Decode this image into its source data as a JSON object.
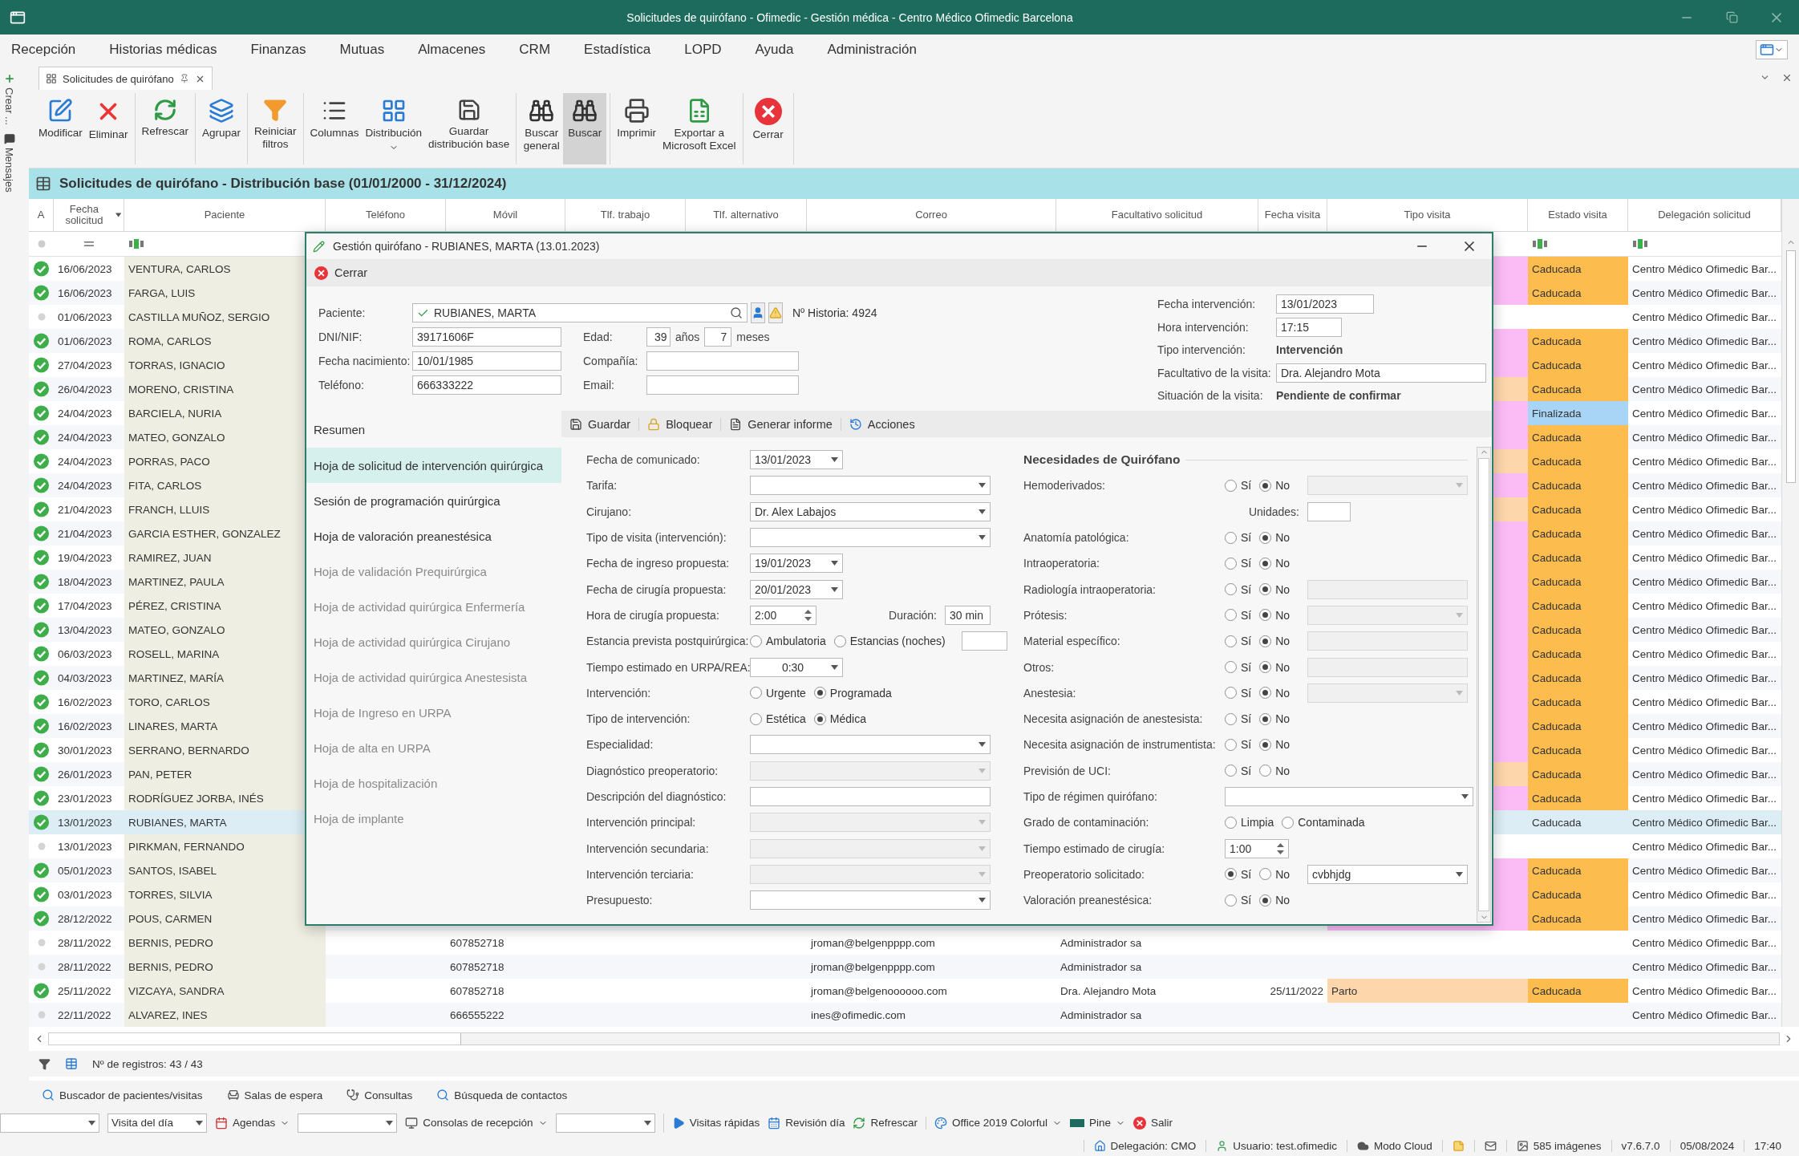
{
  "window": {
    "title": "Solicitudes de quirófano - Ofimedic - Gestión médica - Centro Médico Ofimedic Barcelona"
  },
  "menu": [
    "Recepción",
    "Historias médicas",
    "Finanzas",
    "Mutuas",
    "Almacenes",
    "CRM",
    "Estadística",
    "LOPD",
    "Ayuda",
    "Administración"
  ],
  "side_strip": [
    "Crear ...",
    "Mensajes"
  ],
  "doc_tab": {
    "label": "Solicitudes de quirófano"
  },
  "ribbon": {
    "groups": [
      [
        {
          "label": "Modificar",
          "pressed": false,
          "dropdown": false
        },
        {
          "label": "Eliminar",
          "pressed": false,
          "dropdown": false
        }
      ],
      [
        {
          "label": "Refrescar",
          "pressed": false,
          "dropdown": false
        }
      ],
      [
        {
          "label": "Agrupar",
          "pressed": false,
          "dropdown": false
        }
      ],
      [
        {
          "label": "Reiniciar\nfiltros",
          "pressed": false,
          "dropdown": false
        }
      ],
      [
        {
          "label": "Columnas",
          "pressed": false,
          "dropdown": false
        },
        {
          "label": "Distribución",
          "pressed": false,
          "dropdown": true
        },
        {
          "label": "Guardar\ndistribución base",
          "pressed": false,
          "dropdown": false
        }
      ],
      [
        {
          "label": "Buscar\ngeneral",
          "pressed": false,
          "dropdown": false
        },
        {
          "label": "Buscar",
          "pressed": true,
          "dropdown": false
        }
      ],
      [
        {
          "label": "Imprimir",
          "pressed": false,
          "dropdown": false
        },
        {
          "label": "Exportar a\nMicrosoft Excel",
          "pressed": false,
          "dropdown": false
        }
      ],
      [
        {
          "label": "Cerrar",
          "pressed": false,
          "dropdown": false
        }
      ]
    ]
  },
  "grid": {
    "title": "Solicitudes de quirófano - Distribución base (01/01/2000 - 31/12/2024)",
    "columns": [
      {
        "label": "A",
        "sorted": false
      },
      {
        "label": "Fecha solicitud",
        "sorted": true
      },
      {
        "label": "Paciente",
        "sorted": false
      },
      {
        "label": "Teléfono",
        "sorted": false
      },
      {
        "label": "Móvil",
        "sorted": false
      },
      {
        "label": "Tlf. trabajo",
        "sorted": false
      },
      {
        "label": "Tlf. alternativo",
        "sorted": false
      },
      {
        "label": "Correo",
        "sorted": false
      },
      {
        "label": "Facultativo solicitud",
        "sorted": false
      },
      {
        "label": "Fecha visita",
        "sorted": false
      },
      {
        "label": "Tipo visita",
        "sorted": false
      },
      {
        "label": "Estado visita",
        "sorted": false
      },
      {
        "label": "Delegación solicitud",
        "sorted": false
      }
    ],
    "rows": [
      {
        "confirmed": true,
        "fecha": "16/06/2023",
        "paciente": "VENTURA, CARLOS",
        "tipo_visita": {
          "color": "#fbbcf6"
        },
        "estado": {
          "label": "Caducada",
          "color": "#fcbd4e"
        },
        "delegacion": "Centro Médico Ofimedic Bar...",
        "selected": false
      },
      {
        "confirmed": true,
        "fecha": "16/06/2023",
        "paciente": "FARGA, LUIS",
        "tipo_visita": {
          "color": "#fbbcf6"
        },
        "estado": {
          "label": "Caducada",
          "color": "#fcbd4e"
        },
        "delegacion": "Centro Médico Ofimedic Bar...",
        "selected": false
      },
      {
        "confirmed": false,
        "fecha": "01/06/2023",
        "paciente": "CASTILLA MUÑOZ, SERGIO",
        "delegacion": "Centro Médico Ofimedic Bar...",
        "selected": false
      },
      {
        "confirmed": true,
        "fecha": "01/06/2023",
        "paciente": "ROMA, CARLOS",
        "tipo_visita": {
          "color": "#fbbcf6"
        },
        "estado": {
          "label": "Caducada",
          "color": "#fcbd4e"
        },
        "delegacion": "Centro Médico Ofimedic Bar...",
        "selected": false
      },
      {
        "confirmed": true,
        "fecha": "27/04/2023",
        "paciente": "TORRAS, IGNACIO",
        "tipo_visita": {
          "color": "#fbbcf6"
        },
        "estado": {
          "label": "Caducada",
          "color": "#fcbd4e"
        },
        "delegacion": "Centro Médico Ofimedic Bar...",
        "selected": false
      },
      {
        "confirmed": true,
        "fecha": "26/04/2023",
        "paciente": "MORENO, CRISTINA",
        "tipo_visita": {
          "color": "#fdd6ac"
        },
        "estado": {
          "label": "Caducada",
          "color": "#fcbd4e"
        },
        "delegacion": "Centro Médico Ofimedic Bar...",
        "selected": false
      },
      {
        "confirmed": true,
        "fecha": "24/04/2023",
        "paciente": "BARCIELA, NURIA",
        "tipo_visita": {
          "color": "#fbbcf6"
        },
        "estado": {
          "label": "Finalizada",
          "color": "#a8d4f5"
        },
        "delegacion": "Centro Médico Ofimedic Bar...",
        "selected": false
      },
      {
        "confirmed": true,
        "fecha": "24/04/2023",
        "paciente": "MATEO, GONZALO",
        "tipo_visita": {
          "color": "#fbbcf6"
        },
        "estado": {
          "label": "Caducada",
          "color": "#fcbd4e"
        },
        "delegacion": "Centro Médico Ofimedic Bar...",
        "selected": false
      },
      {
        "confirmed": true,
        "fecha": "24/04/2023",
        "paciente": "PORRAS, PACO",
        "tipo_visita": {
          "color": "#fdd6ac"
        },
        "estado": {
          "label": "Caducada",
          "color": "#fcbd4e"
        },
        "delegacion": "Centro Médico Ofimedic Bar...",
        "selected": false
      },
      {
        "confirmed": true,
        "fecha": "24/04/2023",
        "paciente": "FITA, CARLOS",
        "tipo_visita": {
          "color": "#fbbcf6"
        },
        "estado": {
          "label": "Caducada",
          "color": "#fcbd4e"
        },
        "delegacion": "Centro Médico Ofimedic Bar...",
        "selected": false
      },
      {
        "confirmed": true,
        "fecha": "21/04/2023",
        "paciente": "FRANCH, LLUIS",
        "tipo_visita": {
          "color": "#fdd6ac"
        },
        "estado": {
          "label": "Caducada",
          "color": "#fcbd4e"
        },
        "delegacion": "Centro Médico Ofimedic Bar...",
        "selected": false
      },
      {
        "confirmed": true,
        "fecha": "21/04/2023",
        "paciente": "GARCIA ESTHER, GONZALEZ",
        "tipo_visita": {
          "color": "#fbbcf6"
        },
        "estado": {
          "label": "Caducada",
          "color": "#fcbd4e"
        },
        "delegacion": "Centro Médico Ofimedic Bar...",
        "selected": false
      },
      {
        "confirmed": true,
        "fecha": "19/04/2023",
        "paciente": "RAMIREZ, JUAN",
        "tipo_visita": {
          "color": "#fbbcf6"
        },
        "estado": {
          "label": "Caducada",
          "color": "#fcbd4e"
        },
        "delegacion": "Centro Médico Ofimedic Bar...",
        "selected": false
      },
      {
        "confirmed": true,
        "fecha": "18/04/2023",
        "paciente": "MARTINEZ, PAULA",
        "tipo_visita": {
          "color": "#fbbcf6"
        },
        "estado": {
          "label": "Caducada",
          "color": "#fcbd4e"
        },
        "delegacion": "Centro Médico Ofimedic Bar...",
        "selected": false
      },
      {
        "confirmed": true,
        "fecha": "17/04/2023",
        "paciente": "PÉREZ, CRISTINA",
        "tipo_visita": {
          "color": "#fbbcf6"
        },
        "estado": {
          "label": "Caducada",
          "color": "#fcbd4e"
        },
        "delegacion": "Centro Médico Ofimedic Bar...",
        "selected": false
      },
      {
        "confirmed": true,
        "fecha": "13/04/2023",
        "paciente": "MATEO, GONZALO",
        "tipo_visita": {
          "color": "#fbbcf6"
        },
        "estado": {
          "label": "Caducada",
          "color": "#fcbd4e"
        },
        "delegacion": "Centro Médico Ofimedic Bar...",
        "selected": false
      },
      {
        "confirmed": true,
        "fecha": "06/03/2023",
        "paciente": "ROSELL, MARINA",
        "tipo_visita": {
          "color": "#fbbcf6"
        },
        "estado": {
          "label": "Caducada",
          "color": "#fcbd4e"
        },
        "delegacion": "Centro Médico Ofimedic Bar...",
        "selected": false
      },
      {
        "confirmed": true,
        "fecha": "04/03/2023",
        "paciente": "MARTINEZ, MARÍA",
        "tipo_visita": {
          "color": "#fbbcf6"
        },
        "estado": {
          "label": "Caducada",
          "color": "#fcbd4e"
        },
        "delegacion": "Centro Médico Ofimedic Bar...",
        "selected": false
      },
      {
        "confirmed": true,
        "fecha": "16/02/2023",
        "paciente": "TORO, CARLOS",
        "tipo_visita": {
          "color": "#fbbcf6"
        },
        "estado": {
          "label": "Caducada",
          "color": "#fcbd4e"
        },
        "delegacion": "Centro Médico Ofimedic Bar...",
        "selected": false
      },
      {
        "confirmed": true,
        "fecha": "16/02/2023",
        "paciente": "LINARES, MARTA",
        "tipo_visita": {
          "color": "#fbbcf6"
        },
        "estado": {
          "label": "Caducada",
          "color": "#fcbd4e"
        },
        "delegacion": "Centro Médico Ofimedic Bar...",
        "selected": false
      },
      {
        "confirmed": true,
        "fecha": "30/01/2023",
        "paciente": "SERRANO, BERNARDO",
        "tipo_visita": {
          "color": "#fbbcf6"
        },
        "estado": {
          "label": "Caducada",
          "color": "#fcbd4e"
        },
        "delegacion": "Centro Médico Ofimedic Bar...",
        "selected": false
      },
      {
        "confirmed": true,
        "fecha": "26/01/2023",
        "paciente": "PAN, PETER",
        "tipo_visita": {
          "color": "#fdd6ac"
        },
        "estado": {
          "label": "Caducada",
          "color": "#fcbd4e"
        },
        "delegacion": "Centro Médico Ofimedic Bar...",
        "selected": false
      },
      {
        "confirmed": true,
        "fecha": "23/01/2023",
        "paciente": "RODRÍGUEZ JORBA, INÉS",
        "tipo_visita": {
          "color": "#fbbcf6"
        },
        "estado": {
          "label": "Caducada",
          "color": "#fcbd4e"
        },
        "delegacion": "Centro Médico Ofimedic Bar...",
        "selected": false
      },
      {
        "confirmed": true,
        "fecha": "13/01/2023",
        "paciente": "RUBIANES, MARTA",
        "estado": {
          "label": "Caducada"
        },
        "delegacion": "Centro Médico Ofimedic Bar...",
        "selected": true
      },
      {
        "confirmed": false,
        "fecha": "13/01/2023",
        "paciente": "PIRKMAN, FERNANDO",
        "delegacion": "Centro Médico Ofimedic Bar...",
        "selected": false
      },
      {
        "confirmed": true,
        "fecha": "05/01/2023",
        "paciente": "SANTOS, ISABEL",
        "tipo_visita": {
          "color": "#fbbcf6"
        },
        "estado": {
          "label": "Caducada",
          "color": "#fcbd4e"
        },
        "delegacion": "Centro Médico Ofimedic Bar...",
        "selected": false
      },
      {
        "confirmed": true,
        "fecha": "03/01/2023",
        "paciente": "TORRES, SILVIA",
        "tipo_visita": {
          "color": "#fbbcf6"
        },
        "estado": {
          "label": "Caducada",
          "color": "#fcbd4e"
        },
        "delegacion": "Centro Médico Ofimedic Bar...",
        "selected": false
      },
      {
        "confirmed": true,
        "fecha": "28/12/2022",
        "paciente": "POUS, CARMEN",
        "tipo_visita": {
          "color": "#fbbcf6"
        },
        "estado": {
          "label": "Caducada",
          "color": "#fcbd4e"
        },
        "delegacion": "Centro Médico Ofimedic Bar...",
        "selected": false
      },
      {
        "confirmed": false,
        "fecha": "28/11/2022",
        "paciente": "BERNIS, PEDRO",
        "movil": "607852718",
        "correo": "jroman@belgenpppp.com",
        "facultativo": "Administrador sa",
        "delegacion": "Centro Médico Ofimedic Bar...",
        "selected": false
      },
      {
        "confirmed": false,
        "fecha": "28/11/2022",
        "paciente": "BERNIS, PEDRO",
        "movil": "607852718",
        "correo": "jroman@belgenpppp.com",
        "facultativo": "Administrador sa",
        "delegacion": "Centro Médico Ofimedic Bar...",
        "selected": false
      },
      {
        "confirmed": true,
        "fecha": "25/11/2022",
        "paciente": "VIZCAYA, SANDRA",
        "movil": "607852718",
        "correo": "jroman@belgenoooooo.com",
        "facultativo": "Dra. Alejandro Mota",
        "fecha_visita": "25/11/2022",
        "tipo_visita": {
          "label": "Parto",
          "color": "#fdd6ac"
        },
        "estado": {
          "label": "Caducada",
          "color": "#fcbd4e"
        },
        "delegacion": "Centro Médico Ofimedic Bar...",
        "selected": false
      },
      {
        "confirmed": false,
        "fecha": "22/11/2022",
        "paciente": "ALVAREZ, INES",
        "movil": "666555222",
        "correo": "ines@ofimedic.com",
        "facultativo": "Administrador sa",
        "delegacion": "Centro Médico Ofimedic Bar...",
        "selected": false
      }
    ],
    "record_count": "Nº de registros: 43 / 43"
  },
  "dialog": {
    "title": "Gestión quirófano - RUBIANES, MARTA (13.01.2023)",
    "close_label": "Cerrar",
    "patient": {
      "label": "Paciente:",
      "value": "RUBIANES, MARTA",
      "historia": "Nº Historia: 4924",
      "fields": [
        {
          "label": "DNI/NIF:",
          "value": "39171606F"
        },
        {
          "label": "Fecha nacimiento:",
          "value": "10/01/1985"
        },
        {
          "label": "Teléfono:",
          "value": "666333222"
        }
      ],
      "edad": {
        "label": "Edad:",
        "years": "39",
        "years_unit": "años",
        "months": "7",
        "months_unit": "meses"
      },
      "extra": [
        {
          "label": "Compañía:"
        },
        {
          "label": "Email:"
        }
      ]
    },
    "visit": [
      {
        "label": "Fecha intervención:",
        "value": "13/01/2023",
        "kind": "date"
      },
      {
        "label": "Hora intervención:",
        "value": "17:15",
        "kind": "time"
      },
      {
        "label": "Tipo intervención:",
        "value": "Intervención",
        "kind": "bold"
      },
      {
        "label": "Facultativo de la visita:",
        "value": "Dra. Alejandro Mota",
        "kind": "text"
      },
      {
        "label": "Situación de la visita:",
        "value": "Pendiente de confirmar",
        "kind": "bold"
      }
    ],
    "nav": [
      {
        "label": "Resumen",
        "selected": false,
        "disabled": false
      },
      {
        "label": "Hoja de solicitud de intervención quirúrgica",
        "selected": true,
        "disabled": false
      },
      {
        "label": "Sesión de programación quirúrgica",
        "selected": false,
        "disabled": false
      },
      {
        "label": "Hoja de valoración preanestésica",
        "selected": false,
        "disabled": false
      },
      {
        "label": "Hoja de validación Prequirúrgica",
        "selected": false,
        "disabled": true
      },
      {
        "label": "Hoja de actividad quirúrgica Enfermería",
        "selected": false,
        "disabled": true
      },
      {
        "label": "Hoja de actividad quirúrgica Cirujano",
        "selected": false,
        "disabled": true
      },
      {
        "label": "Hoja de actividad quirúrgica Anestesista",
        "selected": false,
        "disabled": true
      },
      {
        "label": "Hoja de Ingreso en URPA",
        "selected": false,
        "disabled": true
      },
      {
        "label": "Hoja de alta en URPA",
        "selected": false,
        "disabled": true
      },
      {
        "label": "Hoja de hospitalización",
        "selected": false,
        "disabled": true
      },
      {
        "label": "Hoja de implante",
        "selected": false,
        "disabled": true
      }
    ],
    "actions": [
      "Guardar",
      "Bloquear",
      "Generar informe",
      "Acciones"
    ],
    "form_left": [
      {
        "label": "Fecha de comunicado:",
        "kind": "date",
        "value": "13/01/2023",
        "disabled": false
      },
      {
        "label": "Tarifa:",
        "kind": "combo",
        "disabled": false
      },
      {
        "label": "Cirujano:",
        "kind": "combo",
        "value": "Dr. Alex Labajos",
        "disabled": false
      },
      {
        "label": "Tipo de visita (intervención):",
        "kind": "combo",
        "disabled": false
      },
      {
        "label": "Fecha de ingreso propuesta:",
        "kind": "date",
        "value": "19/01/2023",
        "disabled": false
      },
      {
        "label": "Fecha de cirugía propuesta:",
        "kind": "date",
        "value": "20/01/2023",
        "disabled": false
      },
      {
        "label": "Hora de cirugía propuesta:",
        "kind": "spin",
        "value": "2:00",
        "disabled": false,
        "extra": {
          "label": "Duración:",
          "kind": "text",
          "value": "30 min",
          "disabled": false
        }
      },
      {
        "label": "Estancia prevista postquirúrgica:",
        "kind": "radio",
        "options": [
          {
            "label": "Ambulatoria",
            "selected": false
          },
          {
            "label": "Estancias (noches)",
            "selected": false
          }
        ],
        "extra": {
          "kind": "text",
          "disabled": false
        }
      },
      {
        "label": "Tiempo estimado en URPA/REA:",
        "kind": "time",
        "value": "0:30",
        "disabled": false
      },
      {
        "label": "Intervención:",
        "kind": "radio",
        "options": [
          {
            "label": "Urgente",
            "selected": false
          },
          {
            "label": "Programada",
            "selected": true
          }
        ]
      },
      {
        "label": "Tipo de intervención:",
        "kind": "radio",
        "options": [
          {
            "label": "Estética",
            "selected": false
          },
          {
            "label": "Médica",
            "selected": true
          }
        ]
      },
      {
        "label": "Especialidad:",
        "kind": "combo",
        "disabled": false
      },
      {
        "label": "Diagnóstico preoperatorio:",
        "kind": "combo",
        "disabled": true
      },
      {
        "label": "Descripción del diagnóstico:",
        "kind": "text",
        "disabled": false
      },
      {
        "label": "Intervención principal:",
        "kind": "combo",
        "disabled": true
      },
      {
        "label": "Intervención secundaria:",
        "kind": "combo",
        "disabled": true
      },
      {
        "label": "Intervención terciaria:",
        "kind": "combo",
        "disabled": true
      },
      {
        "label": "Presupuesto:",
        "kind": "combo",
        "disabled": false
      }
    ],
    "form_right_title": "Necesidades de Quirófano",
    "form_right": [
      {
        "label": "Hemoderivados:",
        "kind": "radio",
        "options": [
          {
            "label": "Sí",
            "selected": false
          },
          {
            "label": "No",
            "selected": true
          }
        ],
        "extra": {
          "kind": "combo",
          "disabled": true
        }
      },
      {
        "kind": "units",
        "label": "Unidades:",
        "disabled": false
      },
      {
        "label": "Anatomía patológica:",
        "kind": "radio",
        "options": [
          {
            "label": "Sí",
            "selected": false
          },
          {
            "label": "No",
            "selected": true
          }
        ]
      },
      {
        "label": "Intraoperatoria:",
        "kind": "radio",
        "options": [
          {
            "label": "Sí",
            "selected": false
          },
          {
            "label": "No",
            "selected": true
          }
        ]
      },
      {
        "label": "Radiología intraoperatoria:",
        "kind": "radio",
        "options": [
          {
            "label": "Sí",
            "selected": false
          },
          {
            "label": "No",
            "selected": true
          }
        ],
        "extra": {
          "kind": "text",
          "disabled": true
        }
      },
      {
        "label": "Prótesis:",
        "kind": "radio",
        "options": [
          {
            "label": "Sí",
            "selected": false
          },
          {
            "label": "No",
            "selected": true
          }
        ],
        "extra": {
          "kind": "combo",
          "disabled": true
        }
      },
      {
        "label": "Material específico:",
        "kind": "radio",
        "options": [
          {
            "label": "Sí",
            "selected": false
          },
          {
            "label": "No",
            "selected": true
          }
        ],
        "extra": {
          "kind": "text",
          "disabled": true
        }
      },
      {
        "label": "Otros:",
        "kind": "radio",
        "options": [
          {
            "label": "Sí",
            "selected": false
          },
          {
            "label": "No",
            "selected": true
          }
        ],
        "extra": {
          "kind": "text",
          "disabled": true
        }
      },
      {
        "label": "Anestesia:",
        "kind": "radio",
        "options": [
          {
            "label": "Sí",
            "selected": false
          },
          {
            "label": "No",
            "selected": true
          }
        ],
        "extra": {
          "kind": "combo",
          "disabled": true
        }
      },
      {
        "label": "Necesita asignación de anestesista:",
        "kind": "radio",
        "options": [
          {
            "label": "Sí",
            "selected": false
          },
          {
            "label": "No",
            "selected": true
          }
        ]
      },
      {
        "label": "Necesita asignación de instrumentista:",
        "kind": "radio",
        "options": [
          {
            "label": "Sí",
            "selected": false
          },
          {
            "label": "No",
            "selected": true
          }
        ]
      },
      {
        "label": "Previsión de UCI:",
        "kind": "radio",
        "options": [
          {
            "label": "Sí",
            "selected": false
          },
          {
            "label": "No",
            "selected": false
          }
        ]
      },
      {
        "label": "Tipo de régimen quirófano:",
        "kind": "combo",
        "disabled": false
      },
      {
        "label": "Grado de contaminación:",
        "kind": "radio",
        "options": [
          {
            "label": "Limpia",
            "selected": false
          },
          {
            "label": "Contaminada",
            "selected": false
          }
        ]
      },
      {
        "label": "Tiempo estimado de cirugía:",
        "kind": "spin",
        "value": "1:00",
        "disabled": false
      },
      {
        "label": "Preoperatorio solicitado:",
        "kind": "radio",
        "options": [
          {
            "label": "Sí",
            "selected": true
          },
          {
            "label": "No",
            "selected": false
          }
        ],
        "extra": {
          "kind": "combo",
          "value": "cvbhjdg",
          "disabled": false
        }
      },
      {
        "label": "Valoración preanestésica:",
        "kind": "radio",
        "options": [
          {
            "label": "Sí",
            "selected": false
          },
          {
            "label": "No",
            "selected": true
          }
        ]
      }
    ]
  },
  "shortcuts": [
    "Buscador de pacientes/visitas",
    "Salas de espera",
    "Consultas",
    "Búsqueda de contactos"
  ],
  "quickbar": [
    [
      {
        "kind": "combo"
      },
      {
        "kind": "combo",
        "value": "Visita del día"
      },
      {
        "kind": "menu",
        "label": "Agendas"
      },
      {
        "kind": "combo"
      },
      {
        "kind": "menu",
        "label": "Consolas de recepción"
      },
      {
        "kind": "combo"
      }
    ],
    [
      {
        "kind": "button",
        "label": "Visitas rápidas"
      },
      {
        "kind": "button",
        "label": "Revisión día"
      },
      {
        "kind": "button",
        "label": "Refrescar"
      }
    ],
    [
      {
        "kind": "menu",
        "label": "Office 2019 Colorful"
      },
      {
        "kind": "menu",
        "label": "Pine"
      },
      {
        "kind": "button",
        "label": "Salir"
      }
    ]
  ],
  "status_bar": [
    "Delegación: CMO",
    "Usuario: test.ofimedic",
    "Modo Cloud",
    "585 imágenes",
    "v7.6.7.0",
    "05/08/2024",
    "17:40"
  ]
}
